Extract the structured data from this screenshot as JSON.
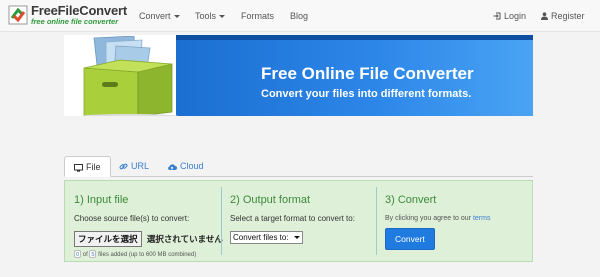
{
  "brand": {
    "name": "FreeFileConvert",
    "tagline": "free online file converter"
  },
  "nav": {
    "items": [
      {
        "label": "Convert"
      },
      {
        "label": "Tools"
      },
      {
        "label": "Formats"
      },
      {
        "label": "Blog"
      }
    ],
    "login": "Login",
    "register": "Register"
  },
  "banner": {
    "title": "Free Online File Converter",
    "subtitle": "Convert your files into different formats."
  },
  "tabs": [
    {
      "label": "File",
      "icon": "monitor-icon",
      "active": true
    },
    {
      "label": "URL",
      "icon": "link-icon"
    },
    {
      "label": "Cloud",
      "icon": "cloud-icon"
    }
  ],
  "steps": {
    "input": {
      "title": "1) Input file",
      "text": "Choose source file(s) to convert:",
      "choose_button": "ファイルを選択",
      "file_status": "選択されていません",
      "count_current": "0",
      "count_of": "of",
      "count_max": "5",
      "files_note": "files added (up to 600 MB combined)"
    },
    "output": {
      "title": "2) Output format",
      "text": "Select a target format to convert to:",
      "select_value": "Convert files to:"
    },
    "convert": {
      "title": "3) Convert",
      "agree_text": "By clicking you agree to our",
      "terms_link": "terms",
      "button": "Convert"
    }
  },
  "colors": {
    "accent": "#1f7be0",
    "panel_bg": "#dff0d8",
    "step_title": "#3c8a3a",
    "brand_green": "#2e9a3b"
  }
}
